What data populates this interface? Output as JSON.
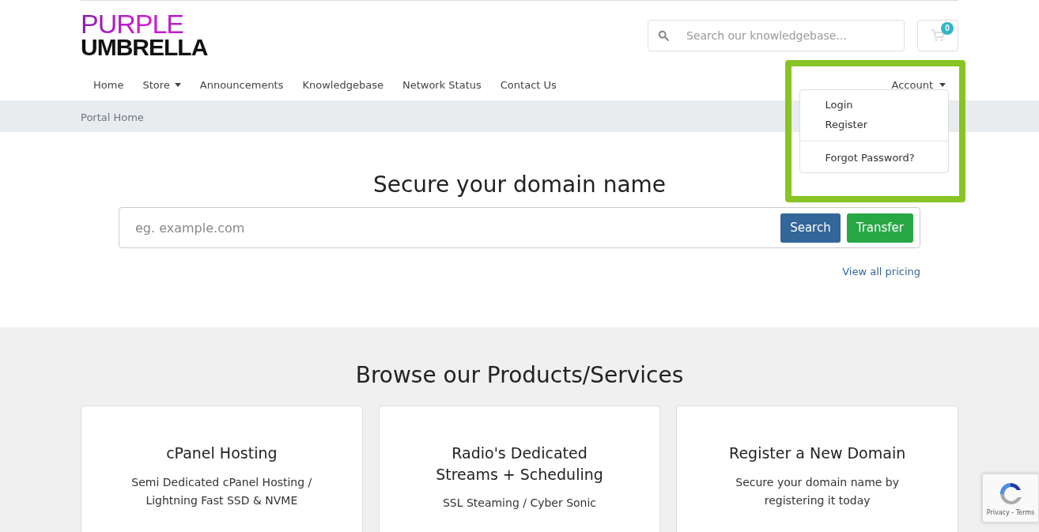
{
  "logo": {
    "line_1": "PURPLE",
    "line_2": "UMBRELLA"
  },
  "header_search": {
    "placeholder": "Search our knowledgebase..."
  },
  "cart": {
    "count": "0"
  },
  "nav": [
    {
      "label": "Home",
      "has_caret": false
    },
    {
      "label": "Store",
      "has_caret": true
    },
    {
      "label": "Announcements",
      "has_caret": false
    },
    {
      "label": "Knowledgebase",
      "has_caret": false
    },
    {
      "label": "Network Status",
      "has_caret": false
    },
    {
      "label": "Contact Us",
      "has_caret": false
    }
  ],
  "account_menu": {
    "label": "Account",
    "expanded": true,
    "highlighted": true,
    "items": [
      {
        "label": "Login",
        "kind": "item"
      },
      {
        "label": "Register",
        "kind": "item"
      },
      {
        "kind": "divider"
      },
      {
        "label": "Forgot Password?",
        "kind": "item"
      }
    ]
  },
  "breadcrumb": [
    "Portal Home"
  ],
  "domain": {
    "title": "Secure your domain name",
    "placeholder": "eg. example.com",
    "buttons": [
      {
        "label": "Search",
        "kind": "primary"
      },
      {
        "label": "Transfer",
        "kind": "success"
      }
    ],
    "pricing_link": "View all pricing"
  },
  "products": {
    "title": "Browse our Products/Services",
    "cards": [
      {
        "title": "cPanel Hosting",
        "description": "Semi Dedicated cPanel Hosting / Lightning Fast SSD & NVME"
      },
      {
        "title": "Radio's Dedicated Streams + Scheduling",
        "description": "SSL Steaming / Cyber Sonic"
      },
      {
        "title": "Register a New Domain",
        "description": "Secure your domain name by registering it today"
      }
    ]
  },
  "recaptcha": {
    "links": "Privacy - Terms"
  }
}
